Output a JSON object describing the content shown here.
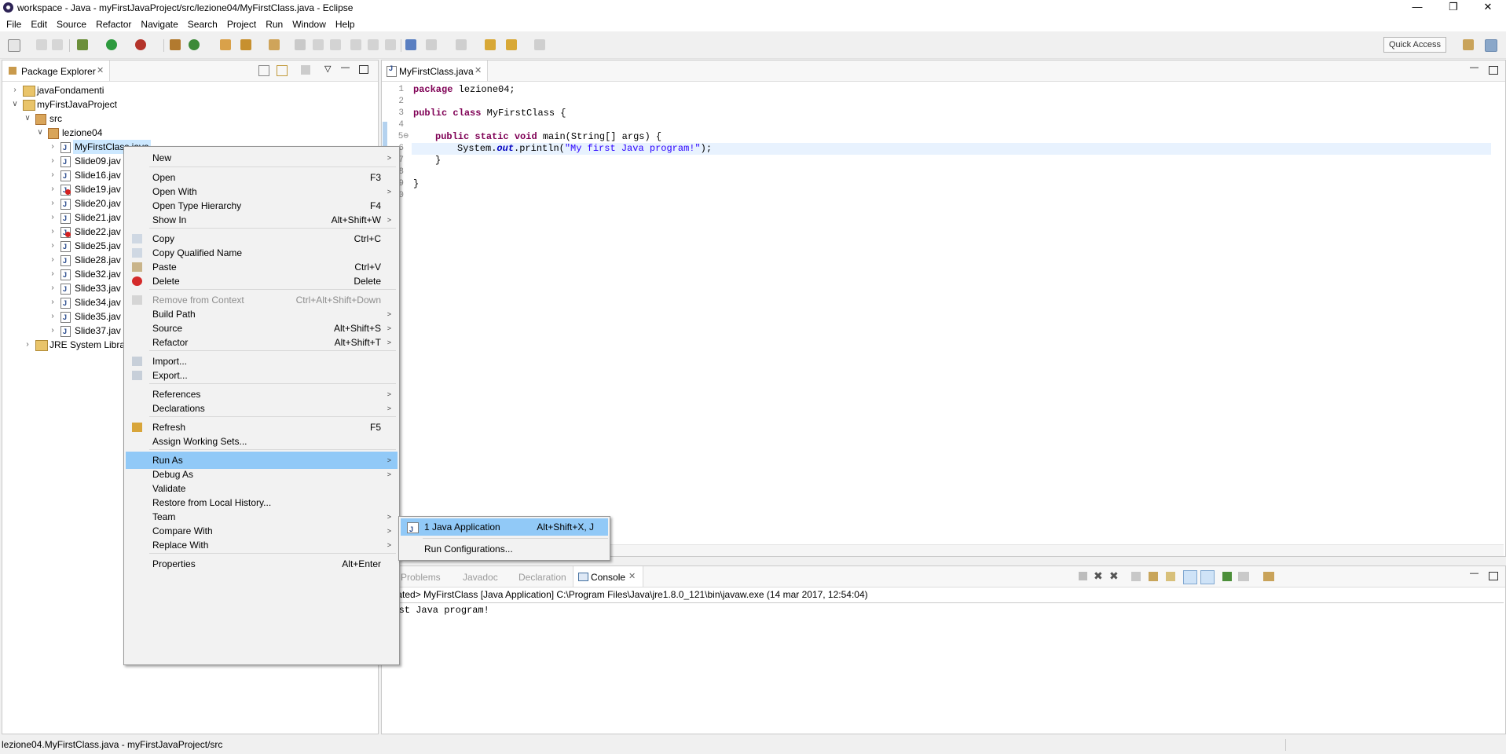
{
  "window": {
    "title": "workspace - Java - myFirstJavaProject/src/lezione04/MyFirstClass.java - Eclipse",
    "controls": [
      "—",
      "❐",
      "✕"
    ]
  },
  "menubar": [
    "File",
    "Edit",
    "Source",
    "Refactor",
    "Navigate",
    "Search",
    "Project",
    "Run",
    "Window",
    "Help"
  ],
  "toolbar": {
    "quick_access": "Quick Access"
  },
  "package_explorer": {
    "title": "Package Explorer",
    "tree": [
      {
        "label": "javaFondamenti",
        "twisty": ">"
      },
      {
        "label": "myFirstJavaProject",
        "twisty": "v"
      },
      {
        "label": "src",
        "twisty": "v"
      },
      {
        "label": "lezione04",
        "twisty": "v"
      },
      {
        "label": "MyFirstClass.java",
        "twisty": ">"
      },
      {
        "label": "Slide09.jav",
        "twisty": ">"
      },
      {
        "label": "Slide16.jav",
        "twisty": ">"
      },
      {
        "label": "Slide19.jav",
        "twisty": ">"
      },
      {
        "label": "Slide20.jav",
        "twisty": ">"
      },
      {
        "label": "Slide21.jav",
        "twisty": ">"
      },
      {
        "label": "Slide22.jav",
        "twisty": ">"
      },
      {
        "label": "Slide25.jav",
        "twisty": ">"
      },
      {
        "label": "Slide28.jav",
        "twisty": ">"
      },
      {
        "label": "Slide32.jav",
        "twisty": ">"
      },
      {
        "label": "Slide33.jav",
        "twisty": ">"
      },
      {
        "label": "Slide34.jav",
        "twisty": ">"
      },
      {
        "label": "Slide35.jav",
        "twisty": ">"
      },
      {
        "label": "Slide37.jav",
        "twisty": ">"
      },
      {
        "label": "JRE System Librar",
        "twisty": ">"
      }
    ]
  },
  "editor": {
    "tab": "MyFirstClass.java",
    "line_numbers": [
      "1",
      "2",
      "3",
      "4",
      "5⊖",
      "6",
      "7",
      "8",
      "9",
      "0"
    ],
    "code": {
      "l1_kw": "package",
      "l1_rest": " lezione04;",
      "l3_kw1": "public",
      "l3_kw2": "class",
      "l3_rest": " MyFirstClass {",
      "l5_kw1": "public",
      "l5_kw2": "static",
      "l5_kw3": "void",
      "l5_rest": " main(String[] args) {",
      "l6_pre": "System.",
      "l6_fld": "out",
      "l6_mid": ".println(",
      "l6_str": "\"My first Java program!\"",
      "l6_end": ");",
      "l7": "}",
      "l9": "}"
    }
  },
  "console": {
    "tabs": [
      "Problems",
      "Javadoc",
      "Declaration",
      "Console"
    ],
    "header": "minated> MyFirstClass [Java Application] C:\\Program Files\\Java\\jre1.8.0_121\\bin\\javaw.exe (14 mar 2017, 12:54:04)",
    "output": "first Java program!"
  },
  "context_menu": {
    "items": [
      {
        "label": "New",
        "shortcut": "",
        "submenu": true
      },
      {
        "label": "Open",
        "shortcut": "F3"
      },
      {
        "label": "Open With",
        "shortcut": "",
        "submenu": true
      },
      {
        "label": "Open Type Hierarchy",
        "shortcut": "F4"
      },
      {
        "label": "Show In",
        "shortcut": "Alt+Shift+W",
        "submenu": true
      },
      {
        "label": "Copy",
        "shortcut": "Ctrl+C"
      },
      {
        "label": "Copy Qualified Name",
        "shortcut": ""
      },
      {
        "label": "Paste",
        "shortcut": "Ctrl+V"
      },
      {
        "label": "Delete",
        "shortcut": "Delete"
      },
      {
        "label": "Remove from Context",
        "shortcut": "Ctrl+Alt+Shift+Down",
        "disabled": true
      },
      {
        "label": "Build Path",
        "shortcut": "",
        "submenu": true
      },
      {
        "label": "Source",
        "shortcut": "Alt+Shift+S",
        "submenu": true
      },
      {
        "label": "Refactor",
        "shortcut": "Alt+Shift+T",
        "submenu": true
      },
      {
        "label": "Import...",
        "shortcut": ""
      },
      {
        "label": "Export...",
        "shortcut": ""
      },
      {
        "label": "References",
        "shortcut": "",
        "submenu": true
      },
      {
        "label": "Declarations",
        "shortcut": "",
        "submenu": true
      },
      {
        "label": "Refresh",
        "shortcut": "F5"
      },
      {
        "label": "Assign Working Sets...",
        "shortcut": ""
      },
      {
        "label": "Run As",
        "shortcut": "",
        "submenu": true,
        "highlighted": true
      },
      {
        "label": "Debug As",
        "shortcut": "",
        "submenu": true
      },
      {
        "label": "Validate",
        "shortcut": ""
      },
      {
        "label": "Restore from Local History...",
        "shortcut": ""
      },
      {
        "label": "Team",
        "shortcut": "",
        "submenu": true
      },
      {
        "label": "Compare With",
        "shortcut": "",
        "submenu": true
      },
      {
        "label": "Replace With",
        "shortcut": "",
        "submenu": true
      },
      {
        "label": "Properties",
        "shortcut": "Alt+Enter"
      }
    ],
    "arrow": ">"
  },
  "run_as_submenu": {
    "items": [
      {
        "label": "1 Java Application",
        "shortcut": "Alt+Shift+X, J",
        "highlighted": true
      },
      {
        "label": "Run Configurations...",
        "shortcut": ""
      }
    ]
  },
  "statusbar": {
    "text": "lezione04.MyFirstClass.java - myFirstJavaProject/src"
  },
  "colors": {
    "menu_highlight": "#91c9f7",
    "keyword": "#7f0055",
    "string": "#2a00ff",
    "current_line": "#e8f2fe"
  }
}
